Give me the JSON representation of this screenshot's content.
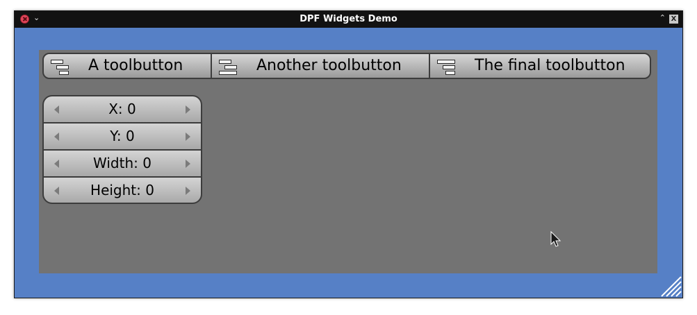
{
  "window": {
    "title": "DPF Widgets Demo"
  },
  "colors": {
    "window_bg": "#5680c6",
    "canvas_bg": "#737373",
    "titlebar_bg": "#121212",
    "close_button": "#e2475b"
  },
  "titlebar_icons": [
    "close-icon",
    "menu-chevron-down-icon",
    "maximize-up-icon",
    "x-logo-icon"
  ],
  "toolbar": {
    "buttons": [
      {
        "label": "A toolbutton",
        "icon": "align-bars-icon"
      },
      {
        "label": "Another toolbutton",
        "icon": "align-bars-icon"
      },
      {
        "label": "The final toolbutton",
        "icon": "align-bars-icon"
      }
    ]
  },
  "spinners": [
    {
      "label": "X: 0"
    },
    {
      "label": "Y: 0"
    },
    {
      "label": "Width: 0"
    },
    {
      "label": "Height: 0"
    }
  ]
}
